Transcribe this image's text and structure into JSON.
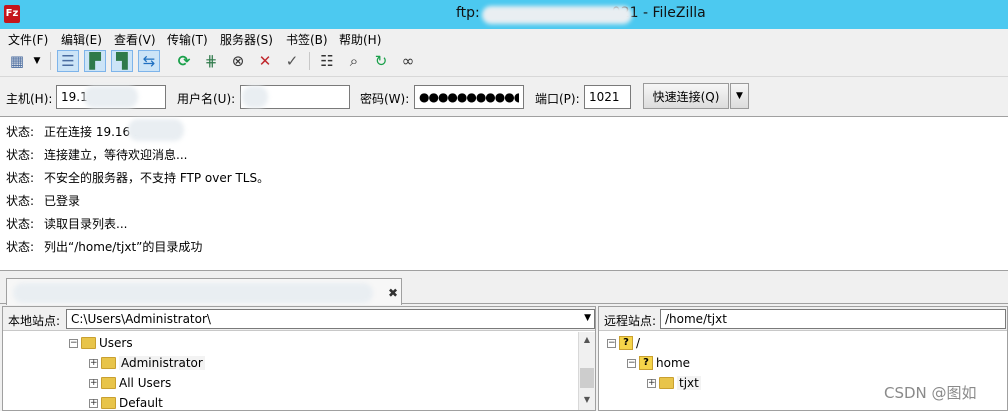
{
  "window": {
    "title_prefix": "ftp:",
    "title_suffix": "021 - FileZilla",
    "app_icon_text": "Fz"
  },
  "menu": [
    "文件(F)",
    "编辑(E)",
    "查看(V)",
    "传输(T)",
    "服务器(S)",
    "书签(B)",
    "帮助(H)"
  ],
  "toolbar": {
    "icons": [
      "site-manager-icon",
      "site-dropdown-icon",
      "toggle-log-icon",
      "toggle-local-tree-icon",
      "toggle-remote-tree-icon",
      "toggle-queue-icon",
      "refresh-icon",
      "process-queue-icon",
      "cancel-icon",
      "disconnect-icon",
      "reconnect-icon",
      "filter-icon",
      "compare-icon",
      "sync-browse-icon",
      "search-icon"
    ]
  },
  "quickconnect": {
    "host_label": "主机(H):",
    "host_value": "19.1",
    "user_label": "用户名(U):",
    "user_value": "",
    "pass_label": "密码(W):",
    "pass_value": "●●●●●●●●●●●●",
    "port_label": "端口(P):",
    "port_value": "1021",
    "connect_label": "快速连接(Q)"
  },
  "log": [
    {
      "kind": "状态:",
      "text": "正在连接 19.16            21..."
    },
    {
      "kind": "状态:",
      "text": "连接建立，等待欢迎消息..."
    },
    {
      "kind": "状态:",
      "text": "不安全的服务器，不支持 FTP over TLS。"
    },
    {
      "kind": "状态:",
      "text": "已登录"
    },
    {
      "kind": "状态:",
      "text": "读取目录列表..."
    },
    {
      "kind": "状态:",
      "text": "列出“/home/tjxt”的目录成功"
    }
  ],
  "tab": {
    "close_glyph": "✖"
  },
  "local": {
    "label": "本地站点:",
    "path": "C:\\Users\\Administrator\\",
    "tree": [
      {
        "name": "Users",
        "expander": "−",
        "icon": "folder-icon"
      },
      {
        "name": "Administrator",
        "expander": "+",
        "icon": "user-folder-icon",
        "selected": true
      },
      {
        "name": "All Users",
        "expander": "+",
        "icon": "folder-icon"
      },
      {
        "name": "Default",
        "expander": "+",
        "icon": "folder-icon"
      }
    ]
  },
  "remote": {
    "label": "远程站点:",
    "path": "/home/tjxt",
    "tree": [
      {
        "name": "/",
        "expander": "−",
        "icon": "unknown-folder-icon"
      },
      {
        "name": "home",
        "expander": "−",
        "icon": "unknown-folder-icon"
      },
      {
        "name": "tjxt",
        "expander": "+",
        "icon": "folder-icon",
        "selected": true
      }
    ]
  },
  "watermark": "CSDN @图如"
}
